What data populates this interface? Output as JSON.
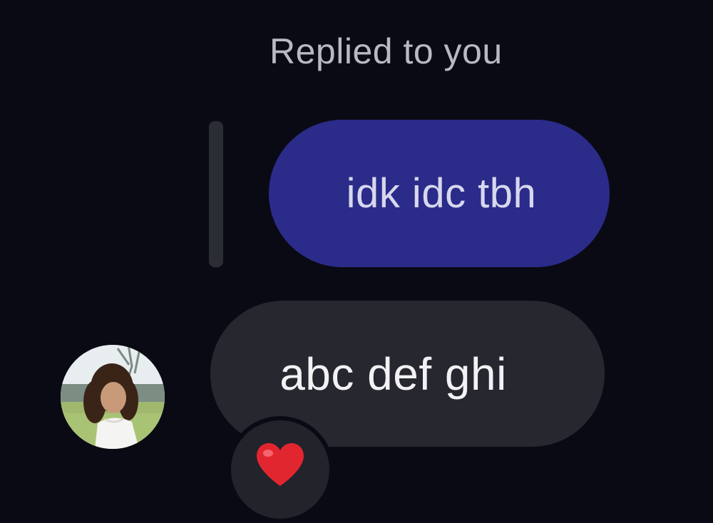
{
  "reply": {
    "label": "Replied to you",
    "quoted_message": "idk idc tbh"
  },
  "message": {
    "text": "abc def ghi",
    "reaction": "heart-icon",
    "sender_avatar": "avatar"
  },
  "colors": {
    "background": "#0a0a14",
    "quoted_bubble": "#2b2b8a",
    "message_bubble": "#26272f",
    "reaction_heart": "#e2262f"
  }
}
